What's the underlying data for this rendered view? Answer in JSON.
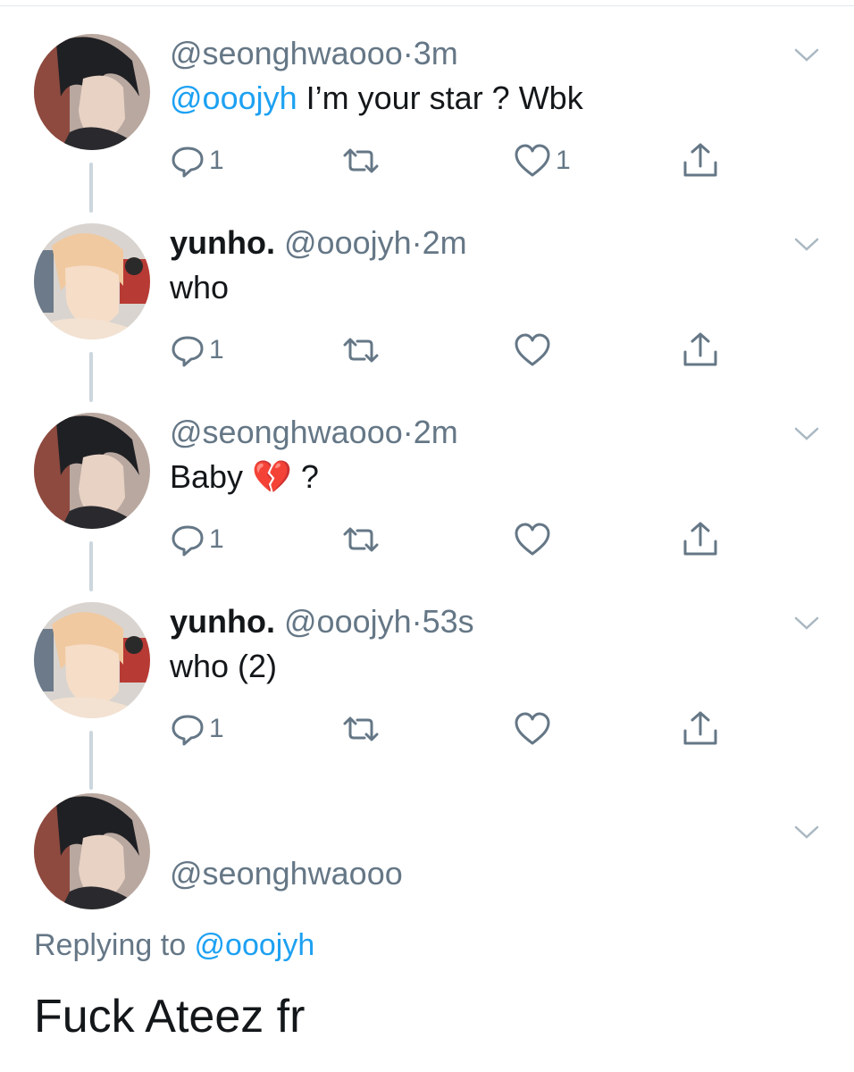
{
  "colors": {
    "accent": "#1da1f2",
    "muted": "#657786",
    "text": "#14171a",
    "thread_line": "#ccd6dd"
  },
  "tweets": [
    {
      "handle": "@seonghwaooo",
      "separator": "·",
      "time": "3m",
      "mention": "@ooojyh",
      "text": " I’m your star ? Wbk",
      "reply_count": "1",
      "like_count": "1",
      "avatar": "avatar-seonghwa"
    },
    {
      "display_name": "yunho.",
      "handle": "@ooojyh",
      "separator": "·",
      "time": "2m",
      "text": "who",
      "reply_count": "1",
      "avatar": "avatar-yunho"
    },
    {
      "handle": "@seonghwaooo",
      "separator": "·",
      "time": "2m",
      "text": "Baby",
      "emoji": "💔",
      "text_after": " ?",
      "reply_count": "1",
      "avatar": "avatar-seonghwa"
    },
    {
      "display_name": "yunho.",
      "handle": "@ooojyh",
      "separator": "·",
      "time": "53s",
      "text": "who (2)",
      "reply_count": "1",
      "avatar": "avatar-yunho"
    }
  ],
  "focused_tweet": {
    "handle": "@seonghwaooo",
    "replying_prefix": "Replying to ",
    "replying_to": "@ooojyh",
    "text": "Fuck Ateez fr",
    "avatar": "avatar-seonghwa"
  },
  "icons": [
    "reply-icon",
    "retweet-icon",
    "like-icon",
    "share-icon",
    "chevron-down-icon"
  ]
}
